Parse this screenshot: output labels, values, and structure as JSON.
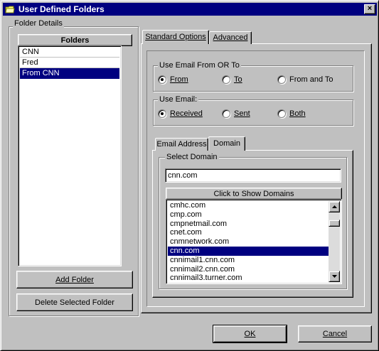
{
  "window": {
    "title": "User Defined Folders",
    "close_label": "×"
  },
  "folder_details": {
    "group_label": "Folder Details",
    "folders_header": "Folders",
    "folders": [
      {
        "name": "CNN",
        "selected": false
      },
      {
        "name": "Fred",
        "selected": false
      },
      {
        "name": "From CNN",
        "selected": true
      }
    ],
    "add_folder_label": "Add Folder",
    "delete_folder_label": "Delete Selected Folder"
  },
  "tabs": [
    {
      "label": "Standard Options",
      "active": true
    },
    {
      "label": "Advanced",
      "active": false
    }
  ],
  "email_from_to": {
    "group_label": "Use Email From  OR  To",
    "options": [
      {
        "label": "From",
        "checked": true
      },
      {
        "label": "To",
        "checked": false
      },
      {
        "label": "From and To",
        "checked": false
      }
    ]
  },
  "use_email": {
    "group_label": "Use Email:",
    "options": [
      {
        "label": "Received",
        "checked": true
      },
      {
        "label": "Sent",
        "checked": false
      },
      {
        "label": "Both",
        "checked": false
      }
    ]
  },
  "inner_tabs": [
    {
      "label": "Email Address",
      "active": false
    },
    {
      "label": "Domain",
      "active": true
    }
  ],
  "domain": {
    "group_label": "Select Domain",
    "input_value": "cnn.com",
    "show_domains_label": "Click to Show Domains",
    "list": [
      {
        "name": "cmhc.com",
        "selected": false
      },
      {
        "name": "cmp.com",
        "selected": false
      },
      {
        "name": "cmpnetmail.com",
        "selected": false
      },
      {
        "name": "cnet.com",
        "selected": false
      },
      {
        "name": "cnmnetwork.com",
        "selected": false
      },
      {
        "name": "cnn.com",
        "selected": true
      },
      {
        "name": "cnnimail1.cnn.com",
        "selected": false
      },
      {
        "name": "cnnimail2.cnn.com",
        "selected": false
      },
      {
        "name": "cnnimail3.turner.com",
        "selected": false
      }
    ]
  },
  "footer": {
    "ok_label": "OK",
    "cancel_label": "Cancel"
  },
  "colors": {
    "titlebar": "#000080",
    "selection": "#000080",
    "face": "#c0c0c0"
  }
}
